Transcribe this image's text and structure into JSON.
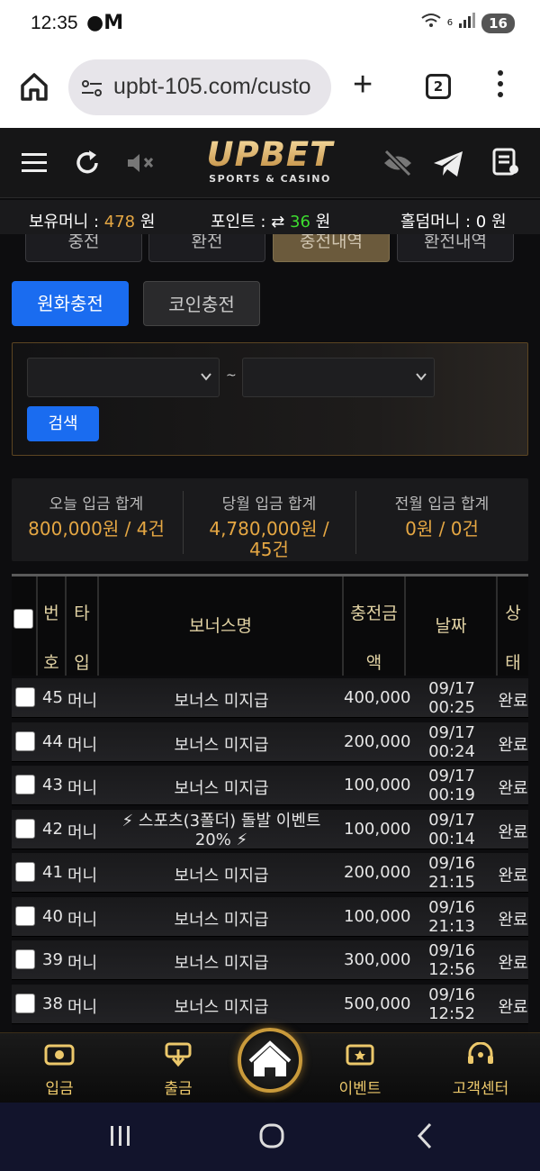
{
  "status": {
    "time": "12:35",
    "notif": "M",
    "battery": "16",
    "signal": "6"
  },
  "browser": {
    "url": "upbt-105.com/custo",
    "tab_count": "2"
  },
  "brand": {
    "logo": "UPBET",
    "tagline": "SPORTS & CASINO",
    "accent": "#e5a743"
  },
  "info": {
    "money_label": "보유머니 :",
    "money_value": "478",
    "money_unit": "원",
    "point_label": "포인트 :",
    "point_value": "36",
    "point_unit": "원",
    "hold_label": "홀덤머니 :",
    "hold_value": "0",
    "hold_unit": "원"
  },
  "tabs": [
    {
      "label": "충전"
    },
    {
      "label": "환전"
    },
    {
      "label": "충전내역"
    },
    {
      "label": "환전내역"
    }
  ],
  "subtabs": [
    {
      "label": "원화충전"
    },
    {
      "label": "코인충전"
    }
  ],
  "filter": {
    "separator": "~",
    "search_label": "검색"
  },
  "summary": [
    {
      "label": "오늘 입금 합계",
      "value": "800,000원 / 4건"
    },
    {
      "label": "당월 입금 합계",
      "value": "4,780,000원 / 45건"
    },
    {
      "label": "전월 입금 합계",
      "value": "0원 / 0건"
    }
  ],
  "table": {
    "headers": {
      "no": "번호",
      "type": "타입",
      "bonus": "보너스명",
      "amount": "충전금액",
      "date": "날짜",
      "status": "상태"
    },
    "rows": [
      {
        "no": "45",
        "type": "머니",
        "bonus": "보너스 미지급",
        "amount": "400,000",
        "date1": "09/17",
        "date2": "00:25",
        "status": "완료"
      },
      {
        "no": "44",
        "type": "머니",
        "bonus": "보너스 미지급",
        "amount": "200,000",
        "date1": "09/17",
        "date2": "00:24",
        "status": "완료"
      },
      {
        "no": "43",
        "type": "머니",
        "bonus": "보너스 미지급",
        "amount": "100,000",
        "date1": "09/17",
        "date2": "00:19",
        "status": "완료"
      },
      {
        "no": "42",
        "type": "머니",
        "bonus": "⚡ 스포츠(3폴더) 돌발 이벤트",
        "bonus2": "20% ⚡",
        "amount": "100,000",
        "date1": "09/17",
        "date2": "00:14",
        "status": "완료"
      },
      {
        "no": "41",
        "type": "머니",
        "bonus": "보너스 미지급",
        "amount": "200,000",
        "date1": "09/16",
        "date2": "21:15",
        "status": "완료"
      },
      {
        "no": "40",
        "type": "머니",
        "bonus": "보너스 미지급",
        "amount": "100,000",
        "date1": "09/16",
        "date2": "21:13",
        "status": "완료"
      },
      {
        "no": "39",
        "type": "머니",
        "bonus": "보너스 미지급",
        "amount": "300,000",
        "date1": "09/16",
        "date2": "12:56",
        "status": "완료"
      },
      {
        "no": "38",
        "type": "머니",
        "bonus": "보너스 미지급",
        "amount": "500,000",
        "date1": "09/16",
        "date2": "12:52",
        "status": "완료"
      }
    ]
  },
  "nav": [
    {
      "label": "입금"
    },
    {
      "label": "출금"
    },
    {
      "label": "이벤트"
    },
    {
      "label": "고객센터"
    }
  ]
}
